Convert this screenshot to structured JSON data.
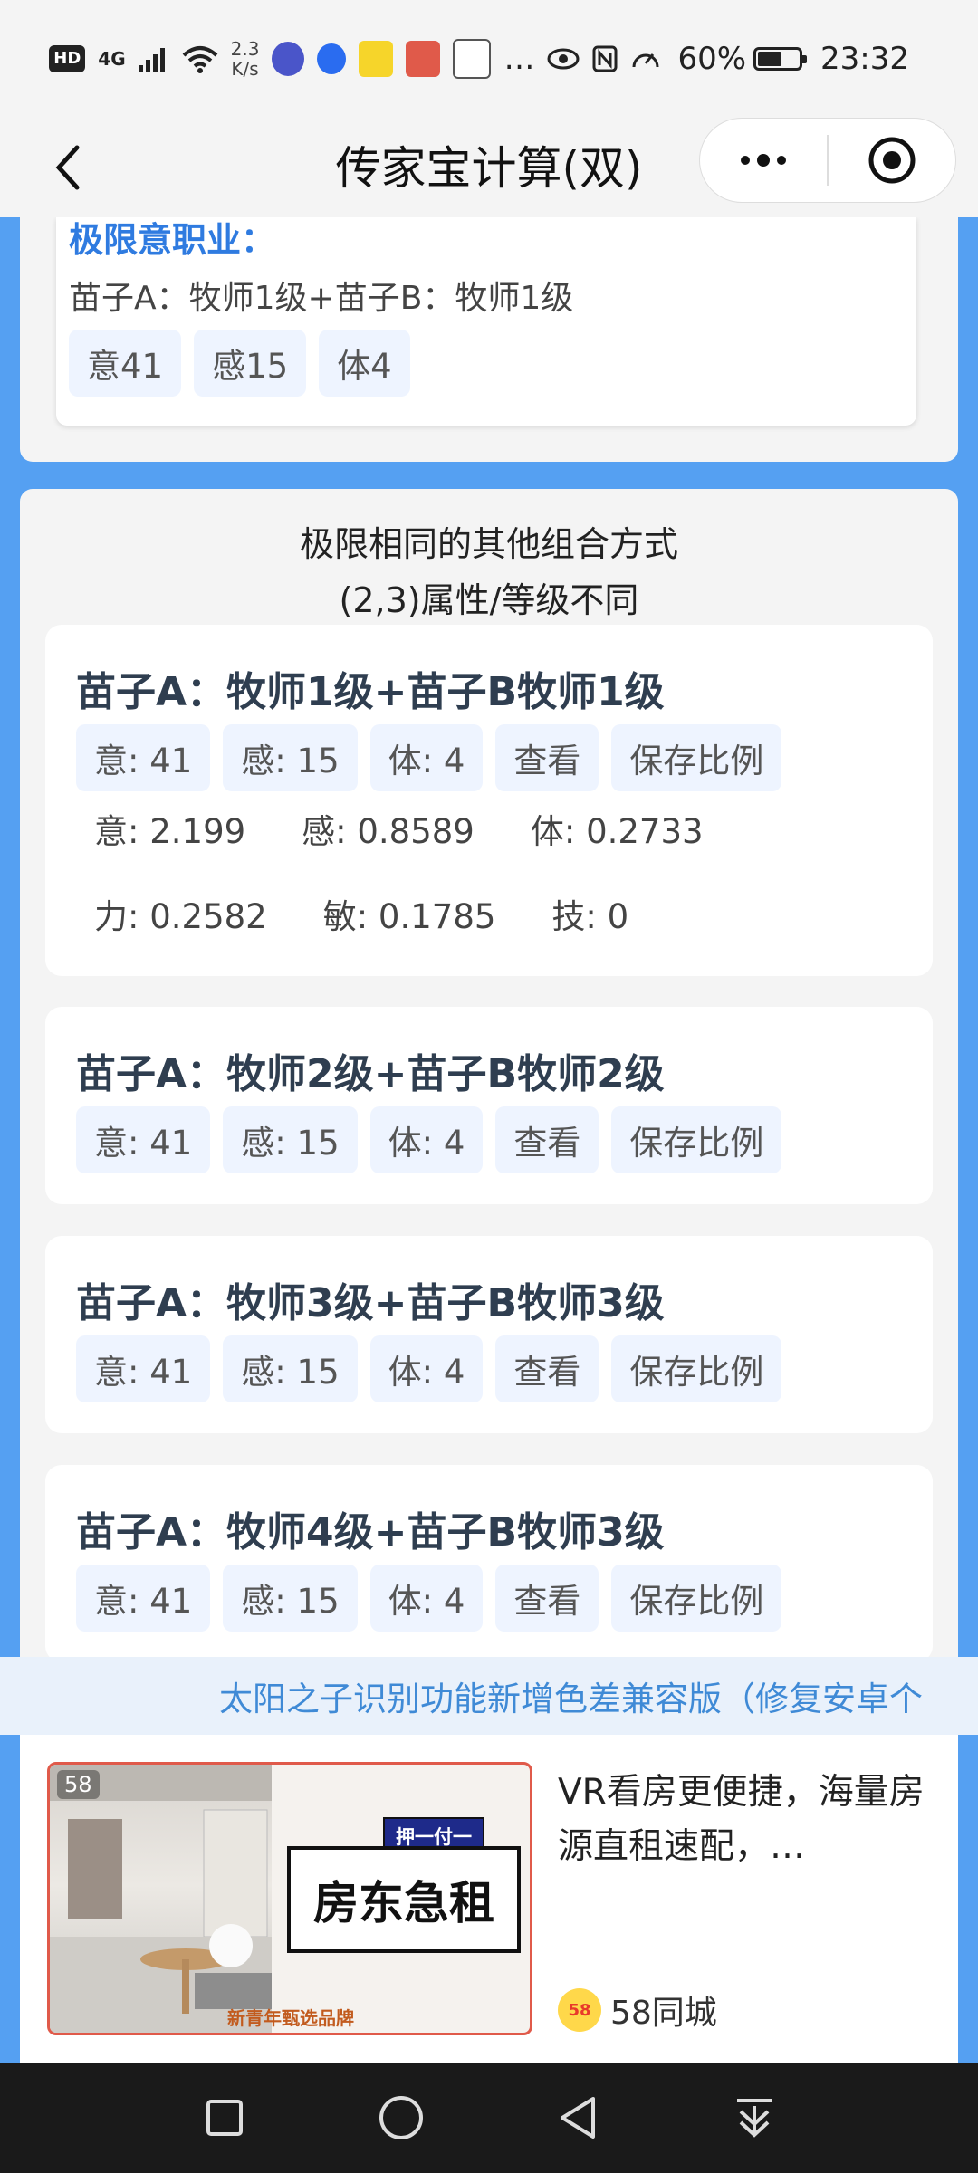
{
  "status_bar": {
    "hd": "HD",
    "network": "4G",
    "speed_value": "2.3",
    "speed_unit": "K/s",
    "more": "…",
    "battery_percent": "60%",
    "battery_level": 0.6,
    "time": "23:32"
  },
  "nav": {
    "title": "传家宝计算(双)"
  },
  "top_result": {
    "heading": "极限意职业：",
    "combo": "苗子A：牧师1级+苗子B：牧师1级",
    "tags": [
      "意41",
      "感15",
      "体4"
    ]
  },
  "other_combos": {
    "title_line1": "极限相同的其他组合方式",
    "title_line2": "(2,3)属性/等级不同",
    "cards": [
      {
        "title": "苗子A：牧师1级+苗子B牧师1级",
        "tags": [
          "意: 41",
          "感: 15",
          "体: 4"
        ],
        "view": "查看",
        "save": "保存比例",
        "ratios_row1": [
          "意: 2.199",
          "感: 0.8589",
          "体: 0.2733"
        ],
        "ratios_row2": [
          "力: 0.2582",
          "敏: 0.1785",
          "技: 0"
        ]
      },
      {
        "title": "苗子A：牧师2级+苗子B牧师2级",
        "tags": [
          "意: 41",
          "感: 15",
          "体: 4"
        ],
        "view": "查看",
        "save": "保存比例"
      },
      {
        "title": "苗子A：牧师3级+苗子B牧师3级",
        "tags": [
          "意: 41",
          "感: 15",
          "体: 4"
        ],
        "view": "查看",
        "save": "保存比例"
      },
      {
        "title": "苗子A：牧师4级+苗子B牧师3级",
        "tags": [
          "意: 41",
          "感: 15",
          "体: 4"
        ],
        "view": "查看",
        "save": "保存比例"
      }
    ]
  },
  "marquee": {
    "text": "太阳之子识别功能新增色差兼容版（修复安卓个"
  },
  "ad": {
    "logo": "58",
    "badge": "押一付一",
    "headline": "房东急租",
    "brand_strip": "新青年甄选品牌",
    "text": "VR看房更便捷，海量房源直租速配，…",
    "source": "58同城",
    "source_logo": "58"
  },
  "colors": {
    "page_blue": "#55a0f2",
    "accent_blue": "#2f7be0",
    "tag_bg": "#eef4ff",
    "title_dark": "#2f3e50"
  }
}
